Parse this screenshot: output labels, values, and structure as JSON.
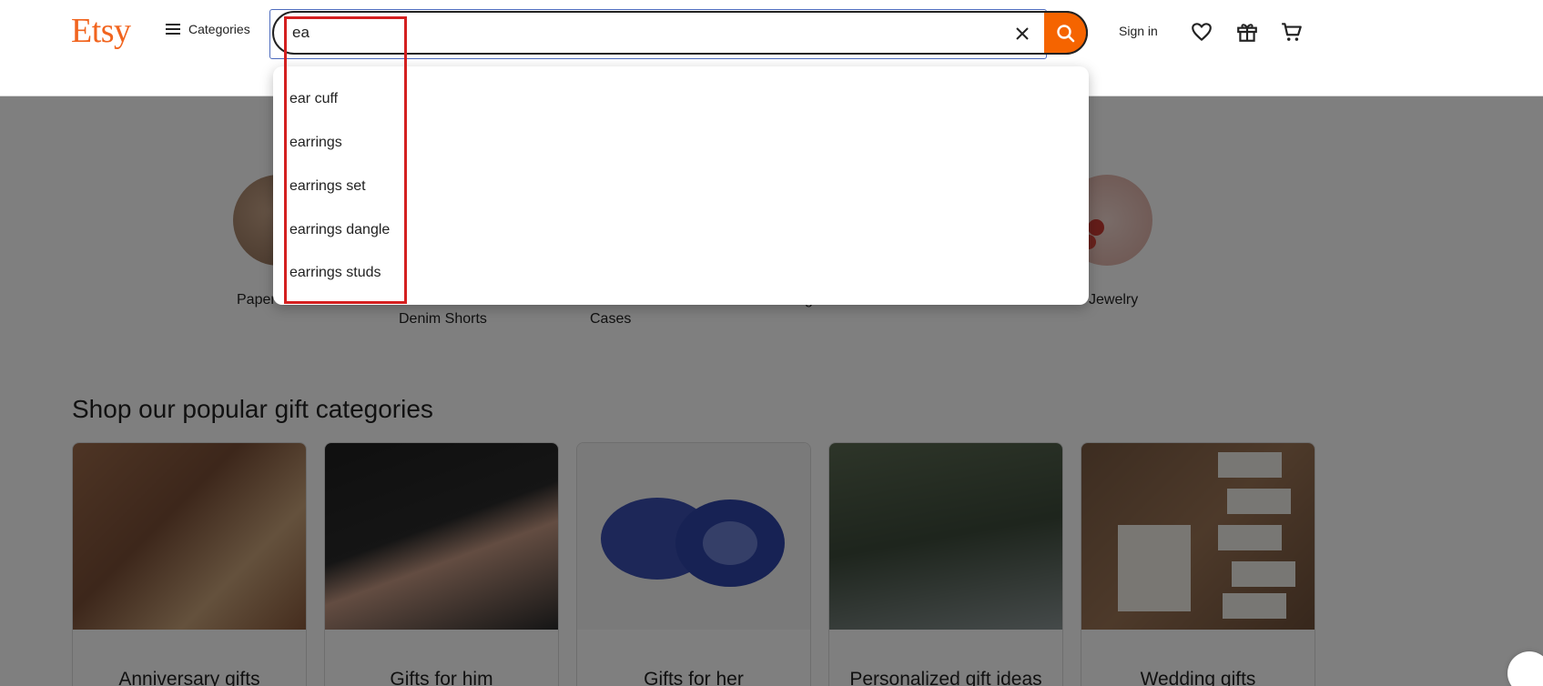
{
  "header": {
    "logo": "Etsy",
    "categories_label": "Categories",
    "search": {
      "value": "ea"
    },
    "signin_label": "Sign in"
  },
  "suggestions": [
    "ear cuff",
    "earrings",
    "earrings set",
    "earrings dangle",
    "earrings studs"
  ],
  "background": {
    "circle_labels": [
      "Paper",
      "Denim Shorts",
      "Cases",
      "g",
      "Jewelry"
    ],
    "section_title": "Shop our popular gift categories",
    "cards": [
      "Anniversary gifts",
      "Gifts for him",
      "Gifts for her",
      "Personalized gift ideas",
      "Wedding gifts"
    ]
  },
  "colors": {
    "brand": "#f1641e",
    "search_button": "#f56400",
    "annotation": "#d42020"
  },
  "icons": [
    "hamburger-icon",
    "close-icon",
    "search-icon",
    "heart-icon",
    "gift-icon",
    "cart-icon"
  ]
}
